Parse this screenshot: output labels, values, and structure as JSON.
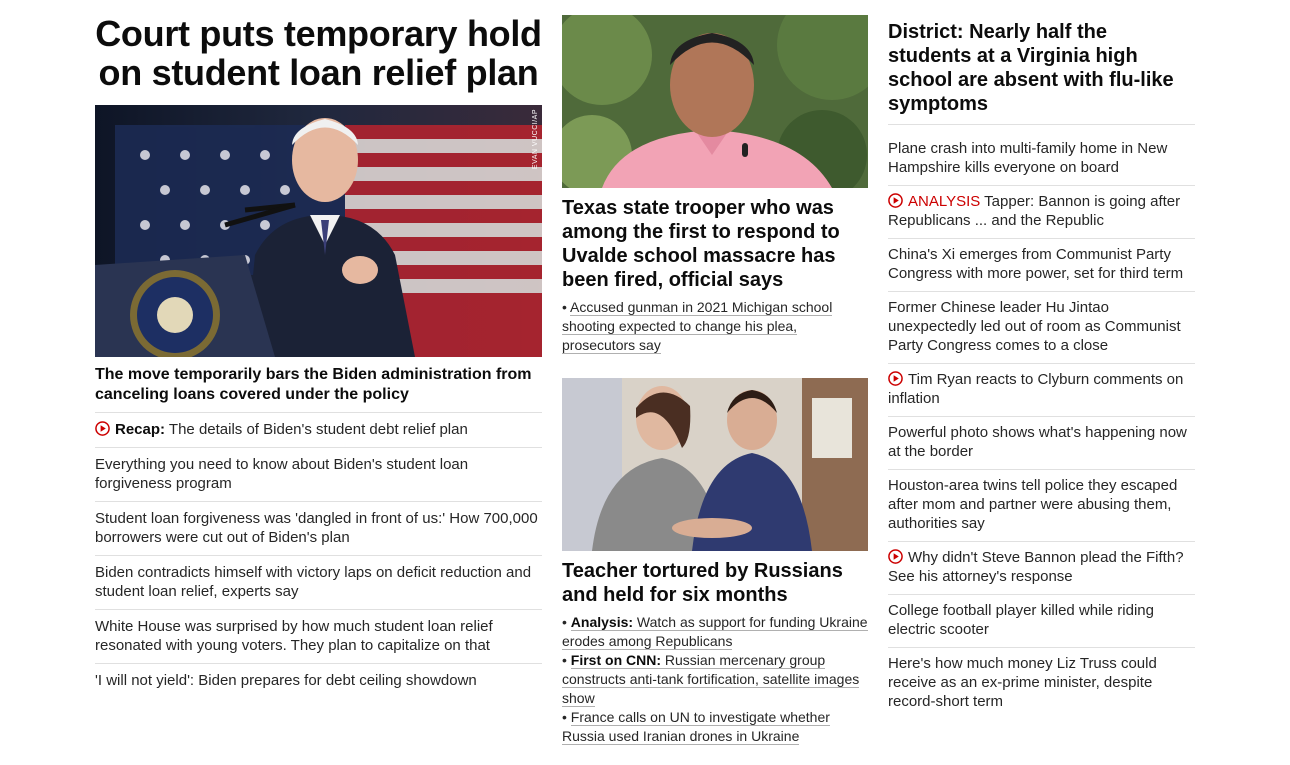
{
  "lead": {
    "title": "Court puts temporary hold on student loan relief plan",
    "image_credit": "EVAN VUCCI/AP",
    "dek": "The move temporarily bars the Biden administration from canceling loans covered under the policy",
    "links": [
      {
        "kicker": "Recap:",
        "text": " The details of Biden's student debt relief plan",
        "video": true
      },
      {
        "text": "Everything you need to know about Biden's student loan forgiveness program"
      },
      {
        "text": "Student loan forgiveness was 'dangled in front of us:' How 700,000 borrowers were cut out of Biden's plan"
      },
      {
        "text": "Biden contradicts himself with victory laps on deficit reduction and student loan relief, experts say"
      },
      {
        "text": "White House was surprised by how much student loan relief resonated with young voters. They plan to capitalize on that"
      },
      {
        "text": "'I will not yield': Biden prepares for debt ceiling showdown"
      }
    ]
  },
  "card1": {
    "title": "Texas state trooper who was among the first to respond to Uvalde school massacre has been fired, official says",
    "subs": [
      {
        "bullet": "• ",
        "text": "Accused gunman in 2021 Michigan school shooting expected to change his plea, prosecutors say"
      }
    ]
  },
  "card2": {
    "title": "Teacher tortured by Russians and held for six months",
    "subs": [
      {
        "bullet": "• ",
        "kicker": "Analysis:",
        "text": " Watch as support for funding Ukraine erodes among Republicans"
      },
      {
        "bullet": "• ",
        "kicker": "First on CNN:",
        "text": " Russian mercenary group constructs anti-tank fortification, satellite images show"
      },
      {
        "bullet": "• ",
        "text": "France calls on UN to investigate whether Russia used Iranian drones in Ukraine"
      }
    ]
  },
  "side": {
    "title": "District: Nearly half the students at a Virginia high school are absent with flu-like symptoms",
    "links": [
      {
        "text": "Plane crash into multi-family home in New Hampshire kills everyone on board"
      },
      {
        "video": true,
        "label": "ANALYSIS",
        "text": " Tapper: Bannon is going after Republicans ... and the Republic"
      },
      {
        "text": "China's Xi emerges from Communist Party Congress with more power, set for third term"
      },
      {
        "text": "Former Chinese leader Hu Jintao unexpectedly led out of room as Communist Party Congress comes to a close"
      },
      {
        "video": true,
        "text": "Tim Ryan reacts to Clyburn comments on inflation"
      },
      {
        "text": "Powerful photo shows what's happening now at the border"
      },
      {
        "text": "Houston-area twins tell police they escaped after mom and partner were abusing them, authorities say"
      },
      {
        "video": true,
        "text": "Why didn't Steve Bannon plead the Fifth? See his attorney's response"
      },
      {
        "text": "College football player killed while riding electric scooter"
      },
      {
        "text": "Here's how much money Liz Truss could receive as an ex-prime minister, despite record-short term"
      }
    ]
  },
  "colors": {
    "accent_red": "#cc0000",
    "divider": "#e0e0e0",
    "text": "#0c0c0c"
  }
}
